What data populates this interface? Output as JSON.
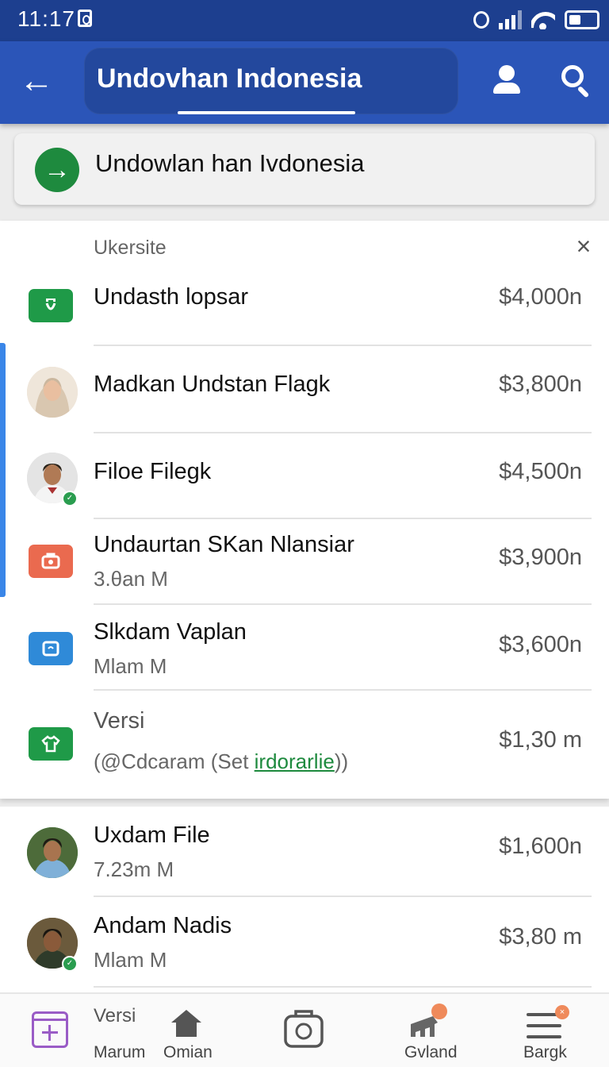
{
  "status_bar": {
    "time": "11:17"
  },
  "app_bar": {
    "back_icon": "arrow-left-icon",
    "title": "Undovhan Indonesia",
    "profile_icon": "person-icon",
    "search_icon": "search-icon",
    "accent": "#2b55b8"
  },
  "suggestion": {
    "icon": "arrow-right-circle-icon",
    "text": "Undowlan han Ivdonesia",
    "color": "#1e8a3e"
  },
  "list": {
    "section_label": "Ukersite",
    "items": [
      {
        "name": "Undasth lopsar",
        "sub": "",
        "price": "$4,000n",
        "icon": "briefcase-icon",
        "icon_color": "#1f9a48"
      },
      {
        "name": "Madkan Undstan Flagk",
        "sub": "",
        "price": "$3,800n",
        "icon": "avatar-woman",
        "icon_color": ""
      },
      {
        "name": "Filoe Filegk",
        "sub": "",
        "price": "$4,500n",
        "icon": "avatar-man",
        "icon_color": ""
      },
      {
        "name": "Undaurtan SKan Nlansiar",
        "sub": "3.θan M",
        "price": "$3,900n",
        "icon": "camera-bag-icon",
        "icon_color": "#ea6a4f"
      },
      {
        "name": "Slkdam Vaplan",
        "sub": "Mlam M",
        "price": "$3,600n",
        "icon": "frame-icon",
        "icon_color": "#2f8ad8"
      },
      {
        "name": "Versi",
        "sub_prefix": "(@Cdcaram (Set ",
        "sub_link": "irdorarlie",
        "sub_suffix": "))",
        "price": "$1,30 m",
        "icon": "shirt-icon",
        "icon_color": "#1f9a48"
      }
    ]
  },
  "lower_list": [
    {
      "name": "Uxdam File",
      "sub": "7.23m M",
      "price": "$1,600n",
      "icon": "avatar-man-2"
    },
    {
      "name": "Andam Nadis",
      "sub": "Mlam M",
      "price": "$3,80 m",
      "icon": "avatar-man-3"
    }
  ],
  "bottom_nav": [
    {
      "label_top": "Versi",
      "label": "Marum",
      "icon": "calendar-add-icon"
    },
    {
      "label": "Omian",
      "icon": "home-icon"
    },
    {
      "label": "",
      "icon": "camera-icon"
    },
    {
      "label": "Gvland",
      "icon": "chart-icon"
    },
    {
      "label": "Bargk",
      "icon": "menu-icon"
    }
  ]
}
